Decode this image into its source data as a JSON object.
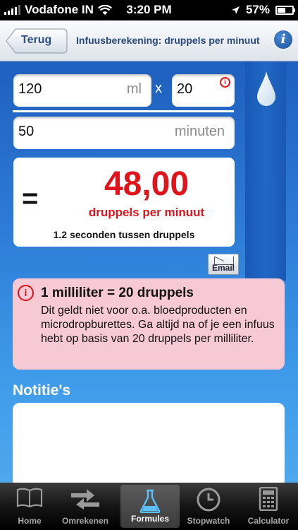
{
  "status": {
    "carrier": "Vodafone IN",
    "time": "3:20 PM",
    "battery": "57%",
    "battery_level": 0.57
  },
  "nav": {
    "back_label": "Terug",
    "title": "Infuusberekening: druppels per minuut",
    "info_icon": "i"
  },
  "form": {
    "volume_value": "120",
    "volume_unit": "ml",
    "times_symbol": "x",
    "drops_value": "20",
    "drops_warn_icon": "i",
    "time_value": "50",
    "time_unit": "minuten"
  },
  "result": {
    "equals": "=",
    "value": "48,00",
    "unit": "druppels per minuut",
    "sub": "1.2 seconden tussen druppels"
  },
  "email_label": "Email",
  "note": {
    "icon": "i",
    "title": "1 milliliter = 20 druppels",
    "body": "Dit geldt niet voor o.a. bloedproducten en microdropburettes. Ga altijd na of je een infuus hebt op basis van 20 druppels per milliliter."
  },
  "notes_label": "Notitie's",
  "tabs": [
    {
      "label": "Home",
      "icon": "book-icon"
    },
    {
      "label": "Omrekenen",
      "icon": "arrows-icon"
    },
    {
      "label": "Formules",
      "icon": "flask-icon",
      "active": true
    },
    {
      "label": "Stopwatch",
      "icon": "clock-icon"
    },
    {
      "label": "Calculator",
      "icon": "calculator-icon"
    }
  ],
  "colors": {
    "result_red": "#e0141c",
    "nav_text": "#28477a",
    "note_bg": "#f7c9d4"
  }
}
